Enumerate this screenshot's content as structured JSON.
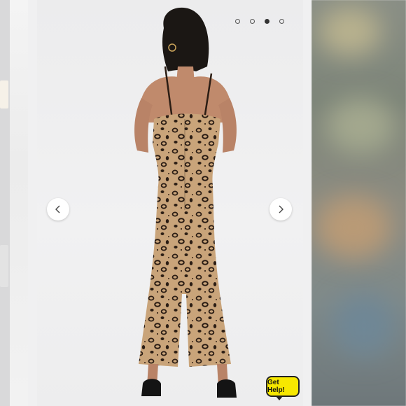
{
  "carousel": {
    "slide_count": 4,
    "active_slide": 3,
    "prev_icon": "chevron-left-icon",
    "next_icon": "chevron-right-icon"
  },
  "help_widget": {
    "label": "Get Help!",
    "color": "#f7e800"
  },
  "colors": {
    "dress_base": "#c9a47a",
    "spot_dark": "#2b1d14",
    "background": "#efeff0"
  }
}
